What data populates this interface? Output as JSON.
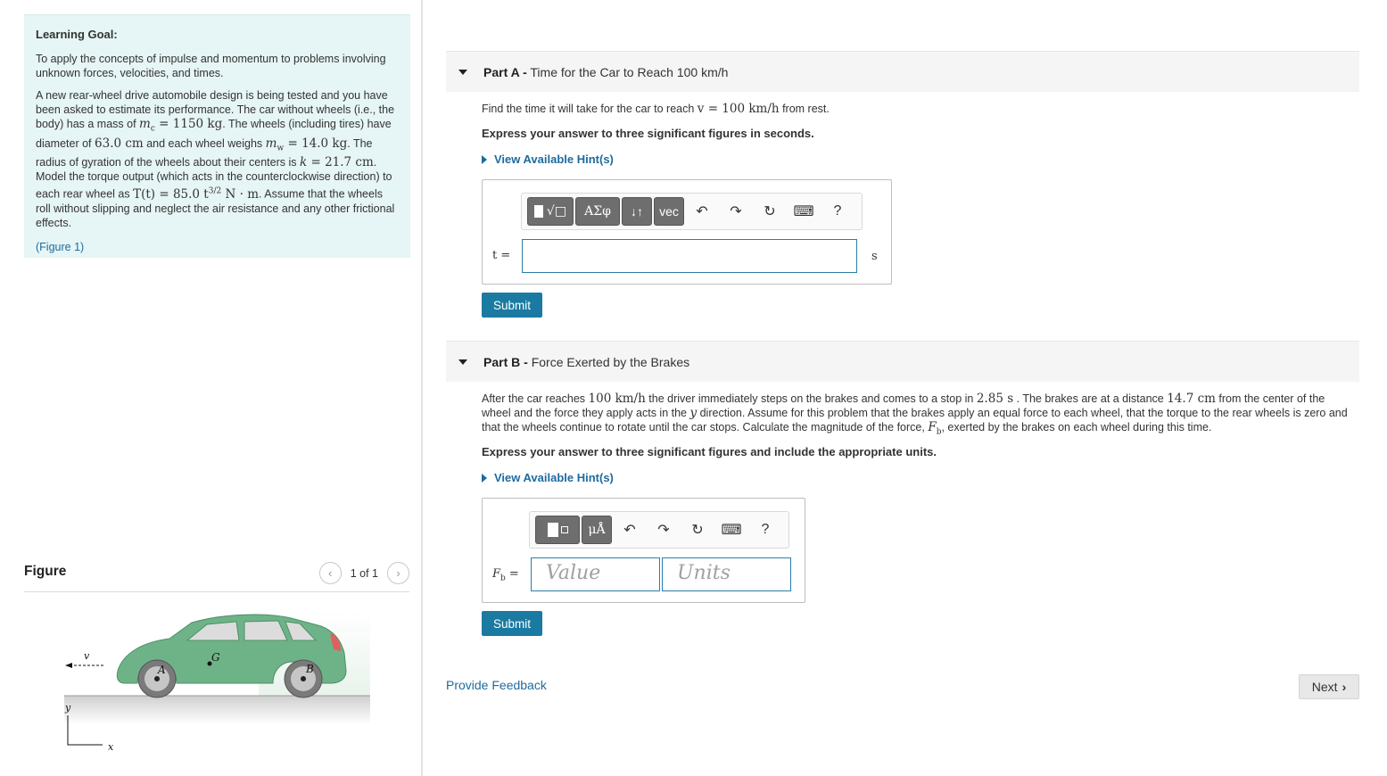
{
  "learning_goal": {
    "title": "Learning Goal:",
    "goal_text": "To apply the concepts of impulse and momentum to problems involving unknown forces, velocities, and times.",
    "problem": {
      "s1": "A new rear-wheel drive automobile design is being tested and you have been asked to estimate its performance. The car without wheels (i.e., the body) has a mass of ",
      "m_c": "m",
      "m_c_sub": "c",
      "m_c_val": " = 1150 kg",
      "s2": ". The wheels (including tires) have diameter of ",
      "diam": "63.0 cm",
      "s3": " and each wheel weighs ",
      "m_w": "m",
      "m_w_sub": "w",
      "m_w_val": " = 14.0 kg",
      "s4": ". The radius of gyration of the wheels about their centers is ",
      "k": "k",
      "k_val": " = 21.7 cm",
      "s5": ". Model the torque output (which acts in the counterclockwise direction) to each rear wheel as ",
      "torque": "T(t) = 85.0 t",
      "torque_exp": "3/2",
      "torque_unit": " N · m",
      "s6": ". Assume that the wheels roll without slipping and neglect the air resistance and any other frictional effects."
    },
    "figure_link": "(Figure 1)"
  },
  "figure": {
    "title": "Figure",
    "count": "1 of 1",
    "labels": {
      "v": "v",
      "A": "A",
      "B": "B",
      "G": "G",
      "y": "y",
      "x": "x"
    },
    "car_color": "#6db387"
  },
  "part_a": {
    "label": "Part A -",
    "title": "Time for the Car to Reach 100 km/h",
    "question_1": "Find the time it will take for the car to reach ",
    "question_math": "v = 100 km/h",
    "question_2": " from rest.",
    "instructions": "Express your answer to three significant figures in seconds.",
    "hint_link": "View Available Hint(s)",
    "toolbar": [
      "ΑΣφ",
      "↓↑",
      "vec",
      "?"
    ],
    "variable": "t =",
    "input_value": "",
    "unit": "s",
    "submit": "Submit"
  },
  "part_b": {
    "label": "Part B -",
    "title": "Force Exerted by the Brakes",
    "q1": "After the car reaches ",
    "q_speed": "100 km/h",
    "q2": " the driver immediately steps on the brakes and comes to a stop in ",
    "q_time": "2.85 s",
    "q3": " . The brakes are at a distance ",
    "q_dist": "14.7 cm",
    "q4": " from the center of the wheel and the force they apply acts in the ",
    "q_dir": "y",
    "q5": " direction. Assume for this problem that the brakes apply an equal force to each wheel, that the torque to the rear wheels is zero and that the wheels continue to rotate until the car stops. Calculate the magnitude of the force, ",
    "q_force": "F",
    "q_force_sub": "b",
    "q6": ", exerted by the brakes on each wheel during this time.",
    "instructions": "Express your answer to three significant figures and include the appropriate units.",
    "hint_link": "View Available Hint(s)",
    "toolbar": [
      "μÅ",
      "?"
    ],
    "variable": "F",
    "variable_sub": "b",
    "variable_eq": " =",
    "value_placeholder": "Value",
    "units_placeholder": "Units",
    "submit": "Submit"
  },
  "footer": {
    "feedback": "Provide Feedback",
    "next": "Next"
  }
}
